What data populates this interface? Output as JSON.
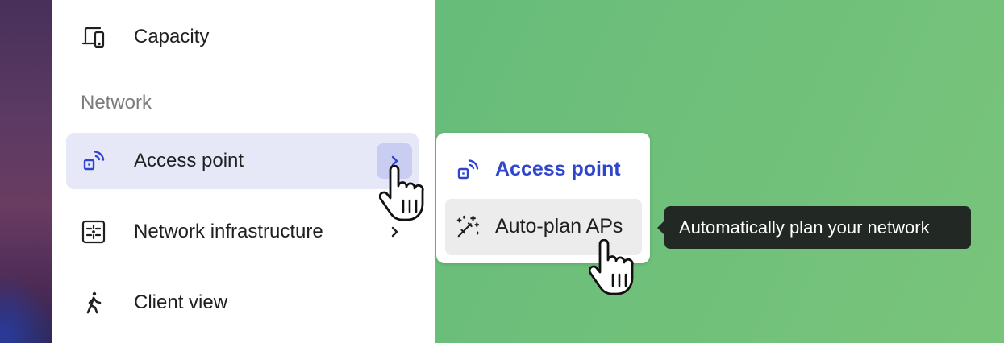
{
  "sidebar": {
    "capacity": {
      "label": "Capacity",
      "icon": "devices-icon"
    },
    "section_title": "Network",
    "access_point": {
      "label": "Access point",
      "icon": "access-point-icon",
      "chevron": "chevron-right-icon",
      "selected": true
    },
    "network_infrastructure": {
      "label": "Network infrastructure",
      "icon": "network-infrastructure-icon",
      "chevron": "chevron-right-icon"
    },
    "client_view": {
      "label": "Client view",
      "icon": "walking-person-icon"
    }
  },
  "submenu": {
    "items": [
      {
        "label": "Access point",
        "icon": "access-point-icon",
        "active": true
      },
      {
        "label": "Auto-plan APs",
        "icon": "magic-wand-icon",
        "hovered": true
      }
    ]
  },
  "tooltip": {
    "text": "Automatically plan your network"
  },
  "colors": {
    "accent": "#2f45cf",
    "selected_row_bg": "#e6e8f8",
    "chevron_bg": "#c9cdf1",
    "hover_bg": "#ececec",
    "tooltip_bg": "#222824",
    "background_green": "#69bd7a"
  },
  "cursors": [
    "hand-pointer-icon",
    "hand-pointer-icon"
  ]
}
